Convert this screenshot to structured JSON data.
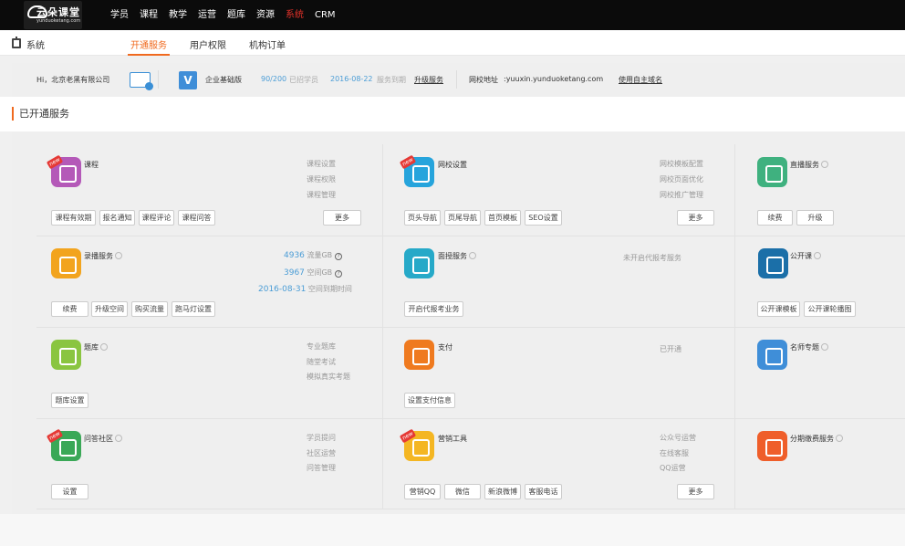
{
  "logo": {
    "name": "云朵课堂",
    "domain": "yunduoketang.com"
  },
  "topnav": [
    "学员",
    "课程",
    "教学",
    "运营",
    "题库",
    "资源",
    "系统",
    "CRM"
  ],
  "subnav": {
    "section": "系统",
    "tabs": [
      "开通服务",
      "用户权限",
      "机构订单"
    ]
  },
  "info": {
    "greeting": "Hi，北京老黑有限公司",
    "plan": "企业基础版",
    "students": "90/200",
    "students_label": "已招学员",
    "expiry": "2016-08-22",
    "expiry_label": "服务到期",
    "upgrade": "升级服务",
    "school_label": "网校地址",
    "school_url": ":yuuxin.yunduoketang.com",
    "own_domain": "使用自主域名"
  },
  "section_title": "已开通服务",
  "badge_new": "new",
  "more_label": "更多",
  "services": {
    "course": {
      "title": "课程",
      "links": [
        "课程设置",
        "课程权限",
        "课程管理"
      ],
      "buttons": [
        "课程有效期",
        "报名通知",
        "课程评论",
        "课程问答"
      ]
    },
    "school": {
      "title": "网校设置",
      "links": [
        "网校模板配置",
        "网校页面优化",
        "网校推广管理"
      ],
      "buttons": [
        "页头导航",
        "页尾导航",
        "首页模板",
        "SEO设置"
      ]
    },
    "live": {
      "title": "直播服务",
      "buttons": [
        "续费",
        "升级"
      ]
    },
    "record": {
      "title": "录播服务",
      "stats": [
        {
          "value": "4936",
          "label": "流量GB"
        },
        {
          "value": "3967",
          "label": "空间GB"
        },
        {
          "value": "2016-08-31",
          "label": "空间到期时间"
        }
      ],
      "buttons": [
        "续费",
        "升级空间",
        "购买流量",
        "跑马灯设置"
      ]
    },
    "exam_signup": {
      "title": "面授服务",
      "status": "未开启代报考服务",
      "buttons": [
        "开启代报考业务"
      ]
    },
    "open_class": {
      "title": "公开课",
      "buttons": [
        "公开课模板",
        "公开课轮播图"
      ]
    },
    "question_bank": {
      "title": "题库",
      "links": [
        "专业题库",
        "随堂考试",
        "模拟真实考题"
      ],
      "buttons": [
        "题库设置"
      ]
    },
    "payment": {
      "title": "支付",
      "status": "已开通",
      "buttons": [
        "设置支付信息"
      ]
    },
    "teacher": {
      "title": "名师专题"
    },
    "qa": {
      "title": "问答社区",
      "links": [
        "学员提问",
        "社区运营",
        "问答管理"
      ],
      "buttons": [
        "设置"
      ]
    },
    "marketing": {
      "title": "营销工具",
      "links": [
        "公众号运营",
        "在线客服",
        "QQ运营"
      ],
      "buttons": [
        "营销QQ",
        "微信",
        "新浪微博",
        "客服电话"
      ]
    },
    "installment": {
      "title": "分期缴费服务"
    }
  },
  "colors": {
    "topbar": "#0b0b0b",
    "accent_orange": "#f06a1f",
    "active_red": "#e6322a",
    "link_blue": "#4b9dd6",
    "course": "#b459b8",
    "school": "#26a4dc",
    "live": "#3fb17f",
    "record": "#f2a41e",
    "exam_signup": "#26a9c8",
    "open_class": "#1b6fa8",
    "question_bank": "#8ac540",
    "payment": "#ef7a1f",
    "teacher": "#3f8ed8",
    "qa": "#3aa857",
    "marketing": "#f4b622",
    "installment": "#ef5e2a"
  }
}
